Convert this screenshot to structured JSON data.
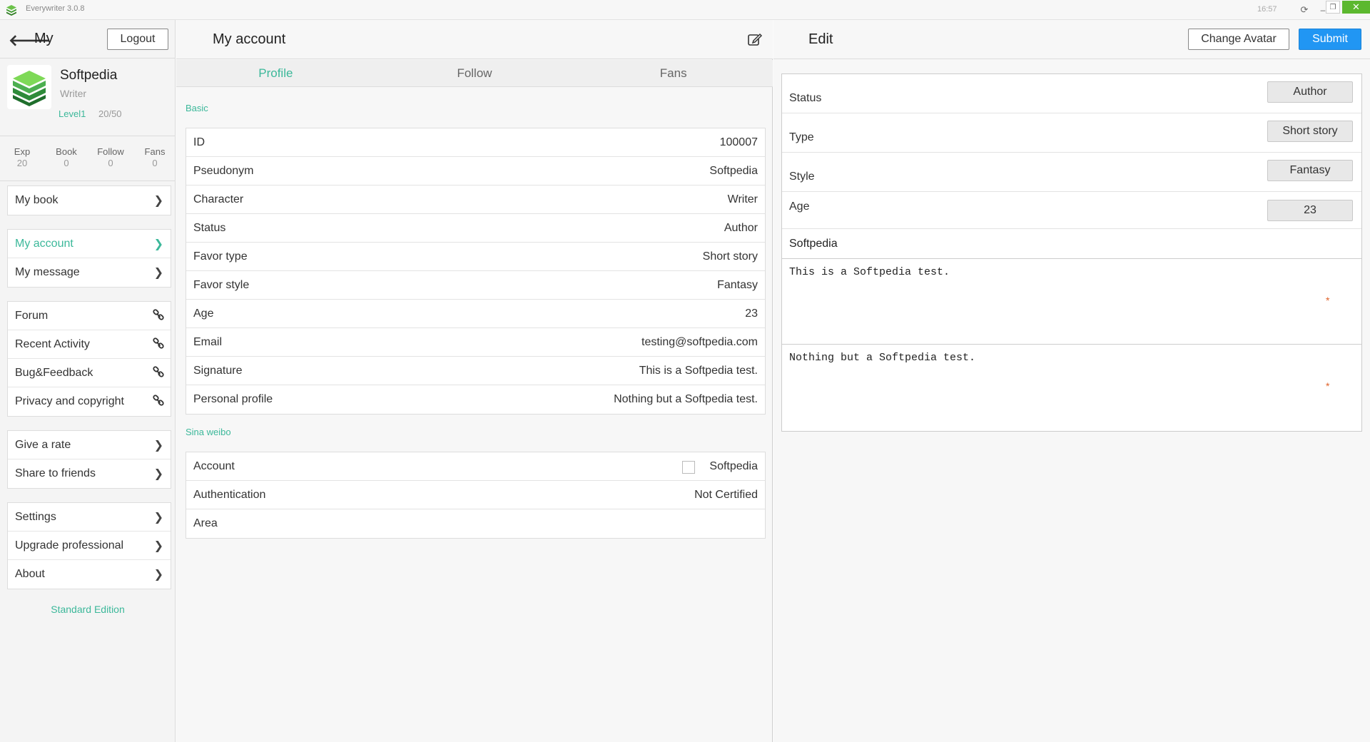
{
  "window": {
    "title": "Everywriter 3.0.8",
    "clock": "16:57"
  },
  "sidebar": {
    "title": "My",
    "logout_label": "Logout",
    "user": {
      "name": "Softpedia",
      "role": "Writer",
      "level": "Level1",
      "exp_progress": "20/50"
    },
    "stats": [
      {
        "label": "Exp",
        "value": "20"
      },
      {
        "label": "Book",
        "value": "0"
      },
      {
        "label": "Follow",
        "value": "0"
      },
      {
        "label": "Fans",
        "value": "0"
      }
    ],
    "groups": [
      [
        {
          "label": "My book",
          "icon": "chevron-right-icon"
        }
      ],
      [
        {
          "label": "My account",
          "icon": "chevron-right-icon",
          "active": true
        },
        {
          "label": "My message",
          "icon": "chevron-right-icon"
        }
      ],
      [
        {
          "label": "Forum",
          "icon": "link-icon"
        },
        {
          "label": "Recent Activity",
          "icon": "link-icon"
        },
        {
          "label": "Bug&Feedback",
          "icon": "link-icon"
        },
        {
          "label": "Privacy and copyright",
          "icon": "link-icon"
        }
      ],
      [
        {
          "label": "Give a rate",
          "icon": "chevron-right-icon"
        },
        {
          "label": "Share to friends",
          "icon": "chevron-right-icon"
        }
      ],
      [
        {
          "label": "Settings",
          "icon": "chevron-right-icon"
        },
        {
          "label": "Upgrade professional",
          "icon": "chevron-right-icon"
        },
        {
          "label": "About",
          "icon": "chevron-right-icon"
        }
      ]
    ],
    "edition": "Standard Edition"
  },
  "account": {
    "title": "My account",
    "tabs": [
      "Profile",
      "Follow",
      "Fans"
    ],
    "basic_label": "Basic",
    "basic": [
      {
        "key": "ID",
        "value": "100007"
      },
      {
        "key": "Pseudonym",
        "value": "Softpedia"
      },
      {
        "key": "Character",
        "value": "Writer"
      },
      {
        "key": "Status",
        "value": "Author"
      },
      {
        "key": "Favor type",
        "value": "Short story"
      },
      {
        "key": "Favor style",
        "value": "Fantasy"
      },
      {
        "key": "Age",
        "value": "23"
      },
      {
        "key": "Email",
        "value": "testing@softpedia.com"
      },
      {
        "key": "Signature",
        "value": "This is a Softpedia test."
      },
      {
        "key": "Personal profile",
        "value": "Nothing but a Softpedia test."
      }
    ],
    "weibo_label": "Sina weibo",
    "weibo": [
      {
        "key": "Account",
        "value": "Softpedia"
      },
      {
        "key": "Authentication",
        "value": "Not Certified"
      },
      {
        "key": "Area",
        "value": ""
      }
    ]
  },
  "edit": {
    "title": "Edit",
    "change_avatar_label": "Change Avatar",
    "submit_label": "Submit",
    "fields": [
      {
        "key": "Status",
        "value": "Author"
      },
      {
        "key": "Type",
        "value": "Short story"
      },
      {
        "key": "Style",
        "value": "Fantasy"
      },
      {
        "key": "Age",
        "value": "23"
      }
    ],
    "name": "Softpedia",
    "signature": "This is a Softpedia test.",
    "profile": "Nothing but a Softpedia test.",
    "required_mark": "*"
  },
  "colors": {
    "accent": "#3cb89a",
    "submit": "#2196f3",
    "close": "#5cb82f"
  }
}
